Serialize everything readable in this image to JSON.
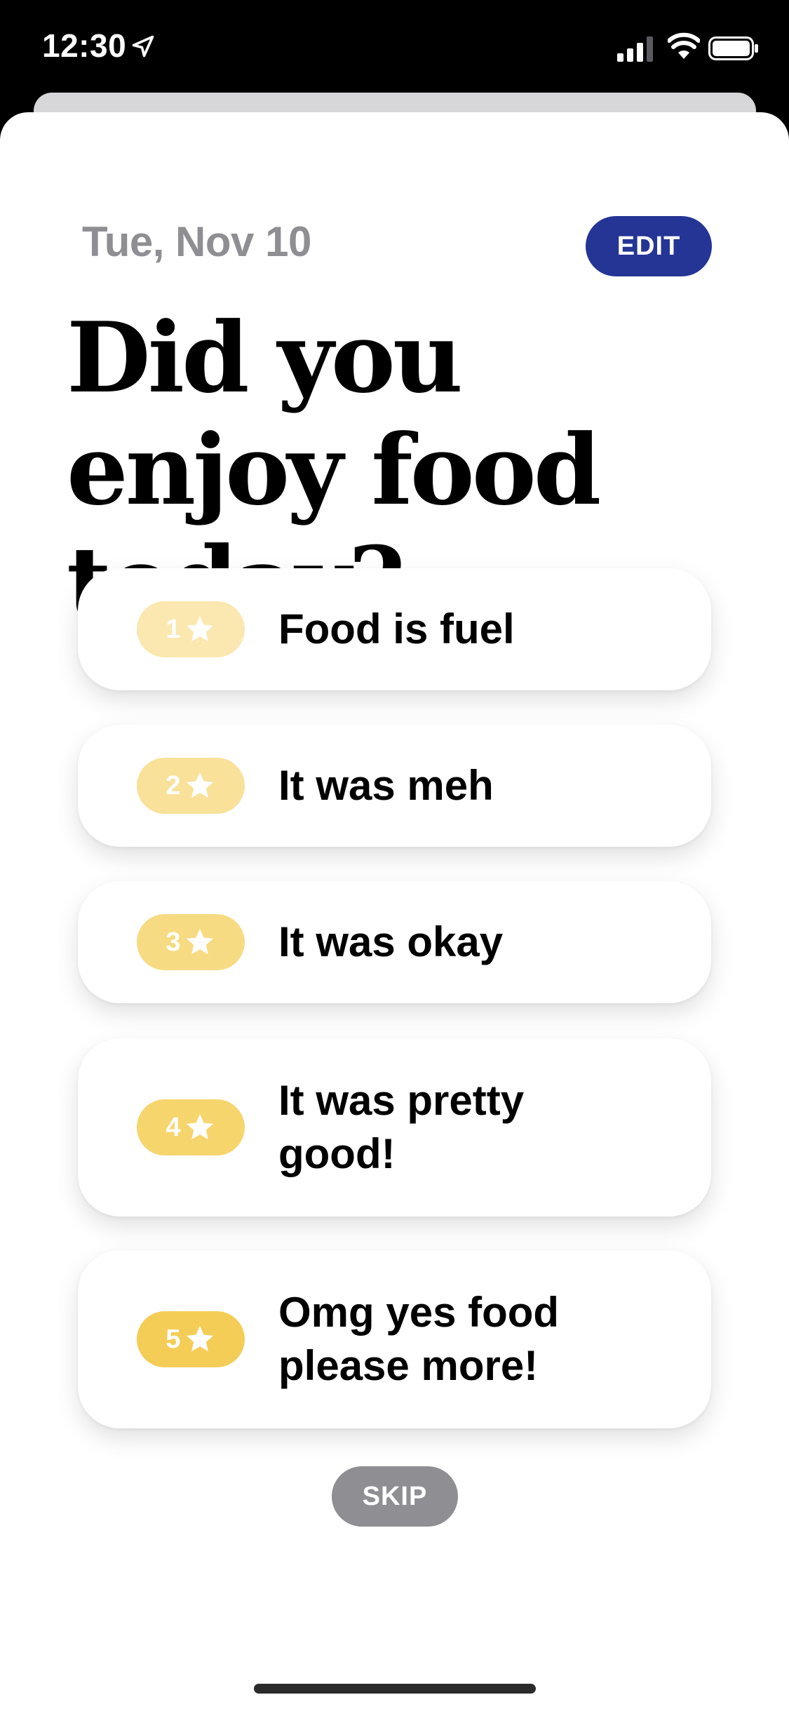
{
  "status_bar": {
    "time": "12:30",
    "icons": [
      "location-arrow-icon",
      "cellular-signal-icon",
      "wifi-icon",
      "battery-icon"
    ]
  },
  "header": {
    "date": "Tue, Nov 10",
    "edit_label": "EDIT"
  },
  "question": "Did you enjoy food today?",
  "options": [
    {
      "rating": "1",
      "label": "Food is fuel",
      "color": "#fbe8b0"
    },
    {
      "rating": "2",
      "label": "It was meh",
      "color": "#f9e19a"
    },
    {
      "rating": "3",
      "label": "It was okay",
      "color": "#f7db82"
    },
    {
      "rating": "4",
      "label": "It was pretty good!",
      "color": "#f6d56d"
    },
    {
      "rating": "5",
      "label": "Omg yes food please more!",
      "color": "#f4cd57"
    }
  ],
  "skip_label": "SKIP",
  "colors": {
    "edit_button": "#243595",
    "skip_button": "#8e8e93",
    "date_text": "#8e8e93"
  }
}
